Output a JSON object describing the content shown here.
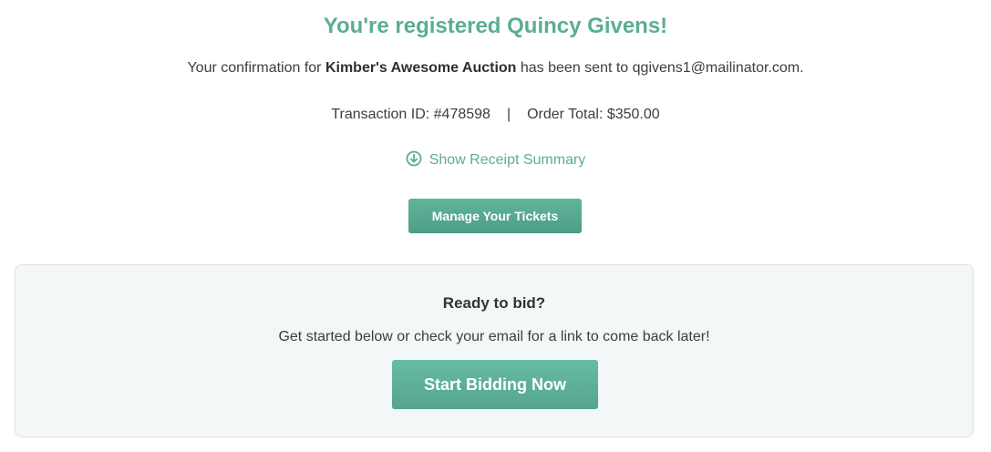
{
  "header": {
    "title": "You're registered Quincy Givens!"
  },
  "confirmation": {
    "prefix": "Your confirmation for ",
    "event_name": "Kimber's Awesome Auction",
    "middle": " has been sent to ",
    "email": "qgivens1@mailinator.com",
    "suffix": "."
  },
  "transaction": {
    "id_label": "Transaction ID: #478598",
    "separator": "|",
    "total_label": "Order Total: $350.00"
  },
  "receipt": {
    "toggle_label": "Show Receipt Summary",
    "icon": "circle-arrow-down-icon"
  },
  "manage": {
    "button_label": "Manage Your Tickets"
  },
  "bidding": {
    "title": "Ready to bid?",
    "text": "Get started below or check your email for a link to come back later!",
    "button_label": "Start Bidding Now"
  },
  "colors": {
    "accent": "#5aae94",
    "card_background": "#f4f7f8",
    "card_border": "#dde2e4",
    "text": "#3d3d3d"
  }
}
